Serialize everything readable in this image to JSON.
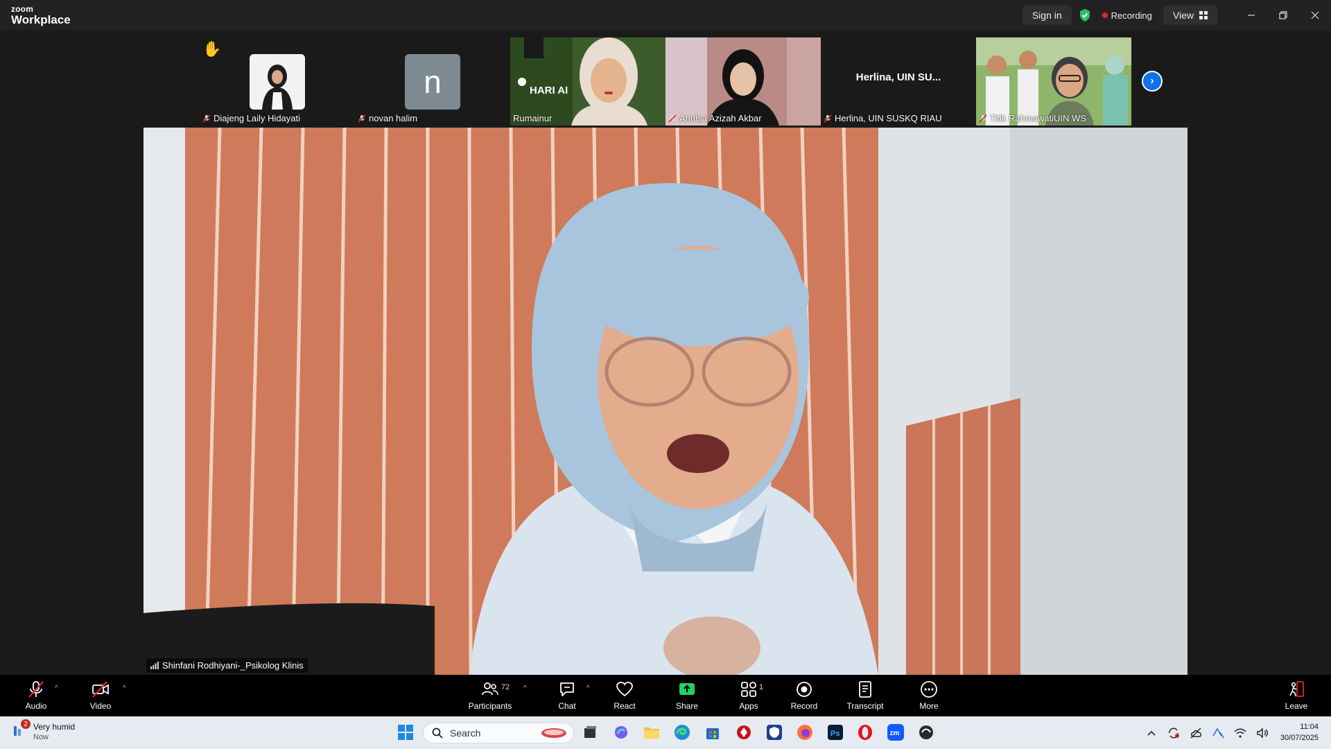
{
  "app": {
    "brand_top": "zoom",
    "brand_bottom": "Workplace",
    "sign_in": "Sign in",
    "recording": "Recording",
    "view": "View"
  },
  "participants_strip": [
    {
      "name": "Diajeng Laily Hidayati",
      "muted": true,
      "hand_raised": true,
      "kind": "photo"
    },
    {
      "name": "novan halim",
      "muted": true,
      "kind": "letter",
      "letter": "n"
    },
    {
      "name": "Rumainur",
      "muted": false,
      "kind": "video",
      "overlay_text": "HARI AI"
    },
    {
      "name": "Annisa Azizah Akbar",
      "muted": true,
      "kind": "video"
    },
    {
      "name": "Herlina, UIN SUSKQ RIAU",
      "muted": true,
      "kind": "text",
      "display_text": "Herlina,  UIN SU..."
    },
    {
      "name": "Titik RahmawatiUIN WS",
      "muted": true,
      "kind": "video"
    }
  ],
  "active_speaker": {
    "name": "Shinfani Rodhiyani-_Psikolog Klinis"
  },
  "toolbar": {
    "audio": "Audio",
    "video": "Video",
    "participants": "Participants",
    "participants_count": "72",
    "chat": "Chat",
    "react": "React",
    "share": "Share",
    "apps": "Apps",
    "apps_count": "1",
    "record": "Record",
    "transcript": "Transcript",
    "more": "More",
    "leave": "Leave"
  },
  "taskbar": {
    "weather_title": "Very humid",
    "weather_sub": "Now",
    "weather_badge": "2",
    "search_placeholder": "Search",
    "time": "11:04",
    "date": "30/07/2025"
  },
  "colors": {
    "accent": "#0e72ed",
    "share_green": "#23d160",
    "recording_red": "#e02828",
    "muted_red": "#e02828"
  }
}
